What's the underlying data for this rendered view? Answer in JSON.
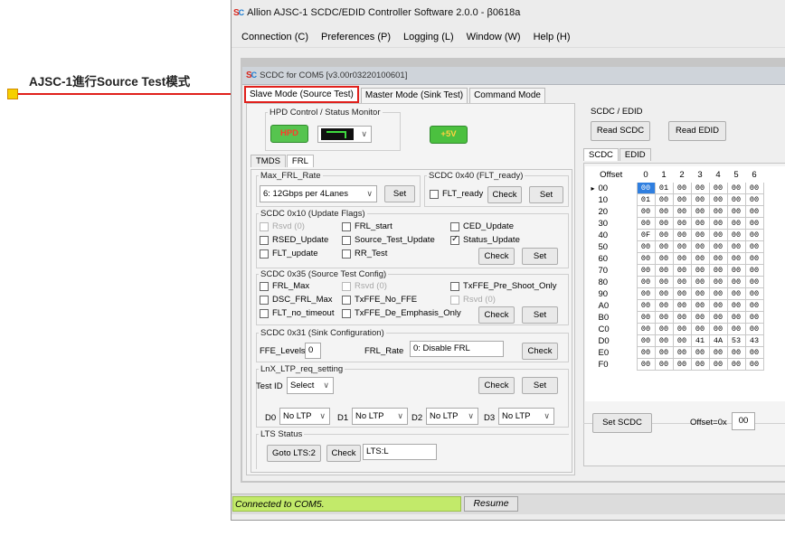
{
  "annotation": {
    "label": "AJSC-1進行Source Test模式"
  },
  "window": {
    "title": "Allion AJSC-1 SCDC/EDID Controller Software 2.0.0 - β0618a"
  },
  "menu": [
    "Connection (C)",
    "Preferences (P)",
    "Logging (L)",
    "Window (W)",
    "Help (H)"
  ],
  "child": {
    "title": "SCDC for COM5 [v3.00r03220100601]",
    "tabs": [
      "Slave Mode (Source Test)",
      "Master Mode (Sink Test)",
      "Command Mode"
    ]
  },
  "hpd": {
    "legend": "HPD Control / Status Monitor",
    "hpd_label": "HPD",
    "v5_label": "+5V"
  },
  "subtabs": [
    "TMDS",
    "FRL"
  ],
  "max_frl": {
    "legend": "Max_FRL_Rate",
    "value": "6: 12Gbps per 4Lanes",
    "set": "Set"
  },
  "x40": {
    "legend": "SCDC 0x40 (FLT_ready)",
    "flt_ready": "FLT_ready",
    "check": "Check",
    "set": "Set"
  },
  "x10": {
    "legend": "SCDC 0x10 (Update Flags)",
    "rsvd": "Rsvd (0)",
    "rsed": "RSED_Update",
    "flt_update": "FLT_update",
    "frl_start": "FRL_start",
    "source_test": "Source_Test_Update",
    "rr_test": "RR_Test",
    "ced": "CED_Update",
    "status": "Status_Update",
    "check": "Check",
    "set": "Set"
  },
  "x35": {
    "legend": "SCDC 0x35 (Source Test Config)",
    "frl_max": "FRL_Max",
    "dsc": "DSC_FRL_Max",
    "flt_no_timeout": "FLT_no_timeout",
    "rsvd1": "Rsvd (0)",
    "txffe_no": "TxFFE_No_FFE",
    "txffe_de": "TxFFE_De_Emphasis_Only",
    "txffe_pre": "TxFFE_Pre_Shoot_Only",
    "rsvd2": "Rsvd (0)",
    "check": "Check",
    "set": "Set"
  },
  "x31": {
    "legend": "SCDC 0x31 (Sink Configuration)",
    "ffe_label": "FFE_Levels",
    "ffe_value": "0",
    "frl_label": "FRL_Rate",
    "frl_value": "0: Disable FRL",
    "check": "Check"
  },
  "lnx": {
    "legend": "LnX_LTP_req_setting",
    "test_id": "Test ID",
    "select": "Select",
    "check": "Check",
    "set": "Set",
    "lanes": [
      {
        "label": "D0",
        "value": "No LTP"
      },
      {
        "label": "D1",
        "value": "No LTP"
      },
      {
        "label": "D2",
        "value": "No LTP"
      },
      {
        "label": "D3",
        "value": "No LTP"
      }
    ]
  },
  "lts": {
    "legend": "LTS Status",
    "goto": "Goto LTS:2",
    "check": "Check",
    "value": "LTS:L"
  },
  "scdc_edid": {
    "legend": "SCDC / EDID",
    "read_scdc": "Read SCDC",
    "read_edid": "Read EDID",
    "tabs": [
      "SCDC",
      "EDID"
    ],
    "offset_header": "Offset",
    "columns": [
      "0",
      "1",
      "2",
      "3",
      "4",
      "5",
      "6"
    ],
    "rows": [
      {
        "offset": "00",
        "cells": [
          "00",
          "01",
          "00",
          "00",
          "00",
          "00",
          "00"
        ]
      },
      {
        "offset": "10",
        "cells": [
          "01",
          "00",
          "00",
          "00",
          "00",
          "00",
          "00"
        ]
      },
      {
        "offset": "20",
        "cells": [
          "00",
          "00",
          "00",
          "00",
          "00",
          "00",
          "00"
        ]
      },
      {
        "offset": "30",
        "cells": [
          "00",
          "00",
          "00",
          "00",
          "00",
          "00",
          "00"
        ]
      },
      {
        "offset": "40",
        "cells": [
          "0F",
          "00",
          "00",
          "00",
          "00",
          "00",
          "00"
        ]
      },
      {
        "offset": "50",
        "cells": [
          "00",
          "00",
          "00",
          "00",
          "00",
          "00",
          "00"
        ]
      },
      {
        "offset": "60",
        "cells": [
          "00",
          "00",
          "00",
          "00",
          "00",
          "00",
          "00"
        ]
      },
      {
        "offset": "70",
        "cells": [
          "00",
          "00",
          "00",
          "00",
          "00",
          "00",
          "00"
        ]
      },
      {
        "offset": "80",
        "cells": [
          "00",
          "00",
          "00",
          "00",
          "00",
          "00",
          "00"
        ]
      },
      {
        "offset": "90",
        "cells": [
          "00",
          "00",
          "00",
          "00",
          "00",
          "00",
          "00"
        ]
      },
      {
        "offset": "A0",
        "cells": [
          "00",
          "00",
          "00",
          "00",
          "00",
          "00",
          "00"
        ]
      },
      {
        "offset": "B0",
        "cells": [
          "00",
          "00",
          "00",
          "00",
          "00",
          "00",
          "00"
        ]
      },
      {
        "offset": "C0",
        "cells": [
          "00",
          "00",
          "00",
          "00",
          "00",
          "00",
          "00"
        ]
      },
      {
        "offset": "D0",
        "cells": [
          "00",
          "00",
          "00",
          "41",
          "4A",
          "53",
          "43"
        ]
      },
      {
        "offset": "E0",
        "cells": [
          "00",
          "00",
          "00",
          "00",
          "00",
          "00",
          "00"
        ]
      },
      {
        "offset": "F0",
        "cells": [
          "00",
          "00",
          "00",
          "00",
          "00",
          "00",
          "00"
        ]
      }
    ],
    "set_scdc": "Set SCDC",
    "offset_label": "Offset=0x",
    "offset_value": "00"
  },
  "status": {
    "connected": "Connected to COM5.",
    "resume": "Resume"
  }
}
